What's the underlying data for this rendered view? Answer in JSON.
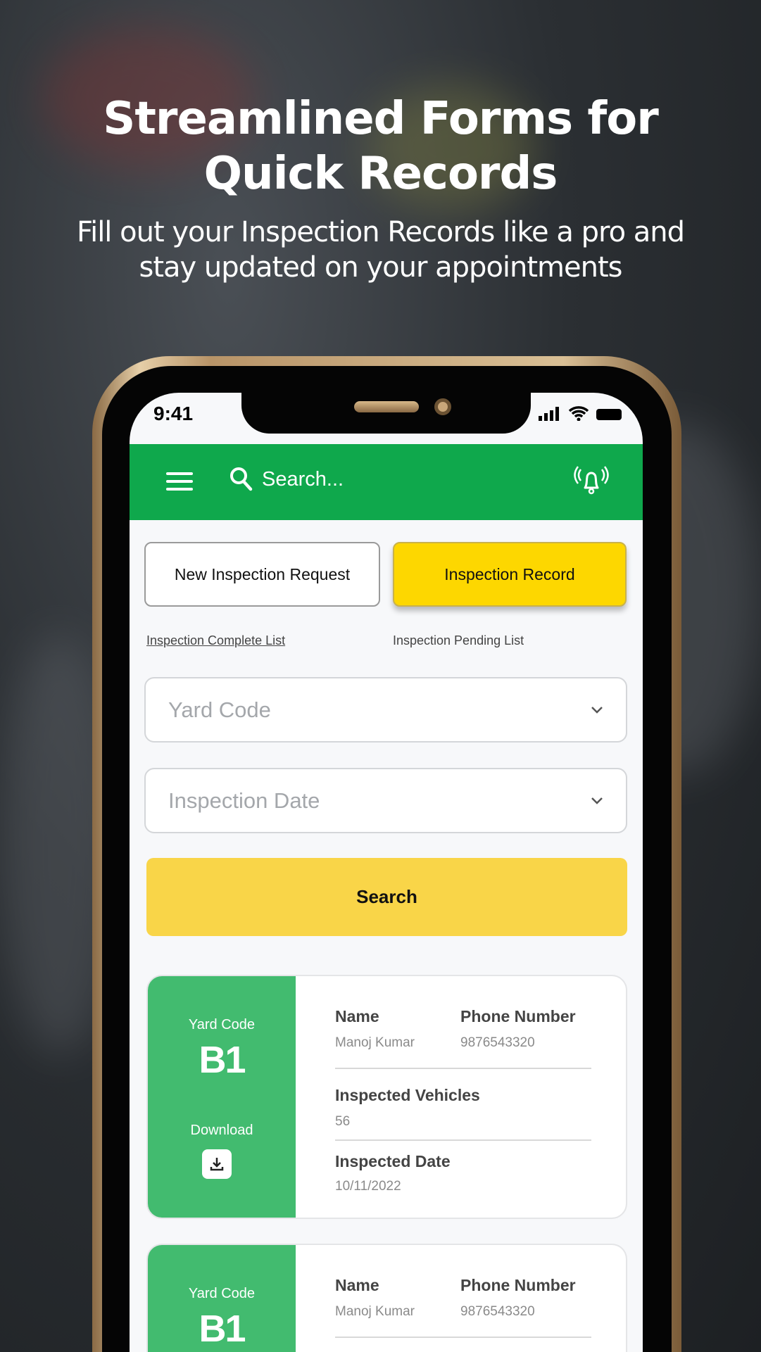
{
  "hero": {
    "title_line1": "Streamlined Forms for",
    "title_line2": "Quick Records",
    "subtitle_line1": "Fill out your Inspection Records like a pro and",
    "subtitle_line2": "stay updated on your appointments"
  },
  "status_bar": {
    "time": "9:41"
  },
  "header": {
    "search_placeholder": "Search...",
    "accent": "#0fa84c"
  },
  "tabs": {
    "new_request": "New Inspection Request",
    "record": "Inspection Record",
    "record_color": "#fdd700"
  },
  "links": {
    "complete": "Inspection Complete  List",
    "pending": "Inspection Pending List"
  },
  "filters": {
    "yard_code": "Yard Code",
    "inspection_date": "Inspection Date"
  },
  "search_button": "Search",
  "cards": [
    {
      "yard_code_label": "Yard Code",
      "yard_code": "B1",
      "download_label": "Download",
      "name_label": "Name",
      "name": "Manoj Kumar",
      "phone_label": "Phone Number",
      "phone": "9876543320",
      "vehicles_label": "Inspected Vehicles",
      "vehicles": "56",
      "date_label": "Inspected Date",
      "date": "10/11/2022"
    },
    {
      "yard_code_label": "Yard Code",
      "yard_code": "B1",
      "name_label": "Name",
      "name": "Manoj Kumar",
      "phone_label": "Phone Number",
      "phone": "9876543320"
    }
  ]
}
